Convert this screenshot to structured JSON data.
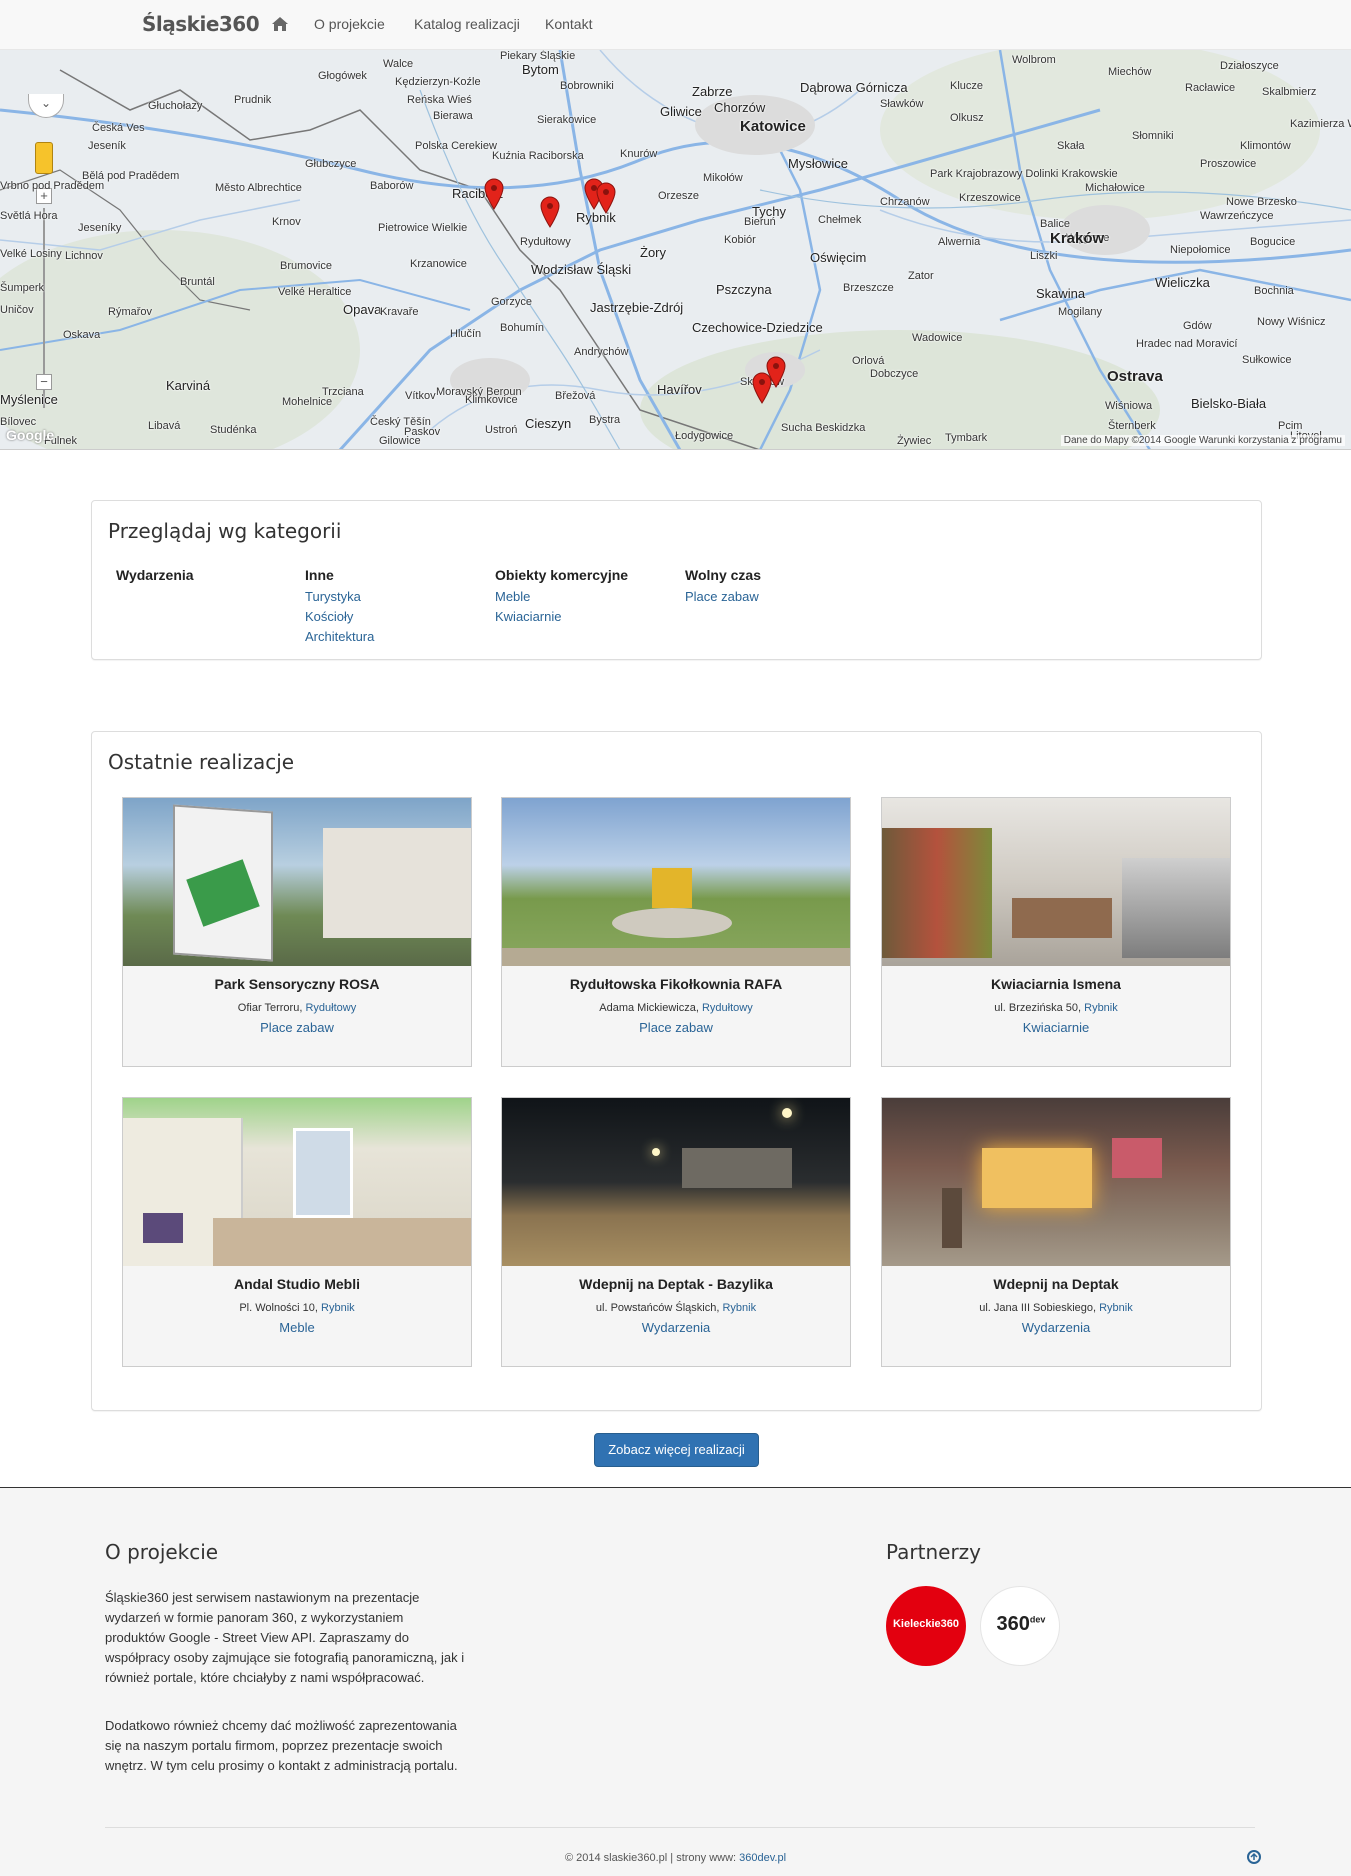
{
  "navbar": {
    "brand": "Śląskie360",
    "links": [
      "O projekcie",
      "Katalog realizacji",
      "Kontakt"
    ]
  },
  "map": {
    "labels": [
      {
        "t": "Walce"
      },
      {
        "t": "Kędzierzyn-Koźle"
      },
      {
        "t": "Piekary Śląskie"
      },
      {
        "t": "Bytom"
      },
      {
        "t": "Wolbrom"
      },
      {
        "t": "Miechów"
      },
      {
        "t": "Działoszyce"
      },
      {
        "t": "Głogówek"
      },
      {
        "t": "Bobrowniki"
      },
      {
        "t": "Prudnik"
      },
      {
        "t": "Zabrze"
      },
      {
        "t": "Dąbrowa Górnicza"
      },
      {
        "t": "Klucze"
      },
      {
        "t": "Racławice"
      },
      {
        "t": "Skalbmierz"
      },
      {
        "t": "Głuchołazy"
      },
      {
        "t": "Reńska Wieś"
      },
      {
        "t": "Gliwice"
      },
      {
        "t": "Chorzów"
      },
      {
        "t": "Katowice"
      },
      {
        "t": "Sławków"
      },
      {
        "t": "Olkusz"
      },
      {
        "t": "Kazimierza Wielka"
      },
      {
        "t": "Česká Ves"
      },
      {
        "t": "Bierawa"
      },
      {
        "t": "Sierakowice"
      },
      {
        "t": "Polska Cerekiew"
      },
      {
        "t": "Kuźnia Raciborska"
      },
      {
        "t": "Knurów"
      },
      {
        "t": "Mysłowice"
      },
      {
        "t": "Słomniki"
      },
      {
        "t": "Jeseník"
      },
      {
        "t": "Skała"
      },
      {
        "t": "Klimontów"
      },
      {
        "t": "Proszowice"
      },
      {
        "t": "Bělá pod Pradědem"
      },
      {
        "t": "Głubczyce"
      },
      {
        "t": "Mikołów"
      },
      {
        "t": "Park Krajobrazowy Dolinki Krakowskie"
      },
      {
        "t": "Baborów"
      },
      {
        "t": "Michałowice"
      },
      {
        "t": "Vrbno pod Pradědem"
      },
      {
        "t": "Město Albrechtice"
      },
      {
        "t": "Racibórz"
      },
      {
        "t": "Rybnik"
      },
      {
        "t": "Orzesze"
      },
      {
        "t": "Chrzanów"
      },
      {
        "t": "Krzeszowice"
      },
      {
        "t": "Nowe Brzesko"
      },
      {
        "t": "Wawrzeńczyce"
      },
      {
        "t": "Jeseníky"
      },
      {
        "t": "Krnov"
      },
      {
        "t": "Pietrowice Wielkie"
      },
      {
        "t": "Tychy"
      },
      {
        "t": "Bieruń"
      },
      {
        "t": "Chełmek"
      },
      {
        "t": "Balice"
      },
      {
        "t": "Węgrzce"
      },
      {
        "t": "Rydułtowy"
      },
      {
        "t": "Kobiór"
      },
      {
        "t": "Alwernia"
      },
      {
        "t": "Kraków"
      },
      {
        "t": "Světlá Hora"
      },
      {
        "t": "Lichnov"
      },
      {
        "t": "Żory"
      },
      {
        "t": "Oświęcim"
      },
      {
        "t": "Liszki"
      },
      {
        "t": "Niepołomice"
      },
      {
        "t": "Bogucice"
      },
      {
        "t": "Brumovice"
      },
      {
        "t": "Krzanowice"
      },
      {
        "t": "Wodzisław Śląski"
      },
      {
        "t": "Zator"
      },
      {
        "t": "Velké Losiny"
      },
      {
        "t": "Bruntál"
      },
      {
        "t": "Velké Heraltice"
      },
      {
        "t": "Pszczyna"
      },
      {
        "t": "Brzeszcze"
      },
      {
        "t": "Skawina"
      },
      {
        "t": "Wieliczka"
      },
      {
        "t": "Bochnia"
      },
      {
        "t": "Gorzyce"
      },
      {
        "t": "Jastrzębie-Zdrój"
      },
      {
        "t": "Rýmařov"
      },
      {
        "t": "Opava"
      },
      {
        "t": "Kravaře"
      },
      {
        "t": "Wadowice"
      },
      {
        "t": "Mogilany"
      },
      {
        "t": "Nowy Wiśnicz"
      },
      {
        "t": "Šumperk"
      },
      {
        "t": "Uničov"
      },
      {
        "t": "Czechowice-Dziedzice"
      },
      {
        "t": "Gdów"
      },
      {
        "t": "Oskava"
      },
      {
        "t": "Hlučín"
      },
      {
        "t": "Bohumín"
      },
      {
        "t": "Hradec nad Moravicí"
      },
      {
        "t": "Orlová"
      },
      {
        "t": "Dobczyce"
      },
      {
        "t": "Andrychów"
      },
      {
        "t": "Sułkowice"
      },
      {
        "t": "Karviná"
      },
      {
        "t": "Trzciana"
      },
      {
        "t": "Moravský Beroun"
      },
      {
        "t": "Břežová"
      },
      {
        "t": "Ostrava"
      },
      {
        "t": "Myślenice"
      },
      {
        "t": "Mohelnice"
      },
      {
        "t": "Vítkov"
      },
      {
        "t": "Klimkovice"
      },
      {
        "t": "Havířov"
      },
      {
        "t": "Skoczów"
      },
      {
        "t": "Bielsko-Biała"
      },
      {
        "t": "Wiśniowa"
      },
      {
        "t": "Bílovec"
      },
      {
        "t": "Český Těšín"
      },
      {
        "t": "Cieszyn"
      },
      {
        "t": "Bystra"
      },
      {
        "t": "Pcim"
      },
      {
        "t": "Šternberk"
      },
      {
        "t": "Libavá"
      },
      {
        "t": "Studénka"
      },
      {
        "t": "Paskov"
      },
      {
        "t": "Ustroń"
      },
      {
        "t": "Łodygowice"
      },
      {
        "t": "Sucha Beskidzka"
      },
      {
        "t": "Tymbark"
      },
      {
        "t": "Litovel"
      },
      {
        "t": "Fulnek"
      },
      {
        "t": "Gilowice"
      },
      {
        "t": "Żywiec"
      }
    ],
    "attribution": "Dane do Mapy ©2014 Google   Warunki korzystania z programu",
    "google_logo": "Google",
    "zoom_in": "+",
    "zoom_out": "−",
    "marker_color": "#e2231a"
  },
  "categories": {
    "title": "Przeglądaj wg kategorii",
    "columns": [
      {
        "head": "Wydarzenia",
        "links": []
      },
      {
        "head": "Inne",
        "links": [
          "Turystyka",
          "Kościoły",
          "Architektura"
        ]
      },
      {
        "head": "Obiekty komercyjne",
        "links": [
          "Meble",
          "Kwiaciarnie"
        ]
      },
      {
        "head": "Wolny czas",
        "links": [
          "Place zabaw"
        ]
      }
    ]
  },
  "recent": {
    "title": "Ostatnie realizacje",
    "cards": [
      {
        "title": "Park Sensoryczny ROSA",
        "street": "Ofiar Terroru, ",
        "city": "Rydułtowy",
        "category": "Place zabaw"
      },
      {
        "title": "Rydułtowska Fikołkownia RAFA",
        "street": "Adama Mickiewicza, ",
        "city": "Rydułtowy",
        "category": "Place zabaw"
      },
      {
        "title": "Kwiaciarnia Ismena",
        "street": "ul. Brzezińska 50, ",
        "city": "Rybnik",
        "category": "Kwiaciarnie"
      },
      {
        "title": "Andal Studio Mebli",
        "street": "Pl. Wolności 10, ",
        "city": "Rybnik",
        "category": "Meble"
      },
      {
        "title": "Wdepnij na Deptak - Bazylika",
        "street": "ul. Powstańców Śląskich, ",
        "city": "Rybnik",
        "category": "Wydarzenia"
      },
      {
        "title": "Wdepnij na Deptak",
        "street": "ul. Jana III Sobieskiego, ",
        "city": "Rybnik",
        "category": "Wydarzenia"
      }
    ],
    "more_button": "Zobacz więcej realizacji"
  },
  "footer": {
    "about_title": "O projekcie",
    "about_p1": "Śląskie360 jest serwisem nastawionym na prezentacje wydarzeń w formie panoram 360, z wykorzystaniem produktów Google - Street View API. Zapraszamy do współpracy osoby zajmujące sie fotografią panoramiczną, jak i również portale, które chciałyby z nami współpracować.",
    "about_p2": "Dodatkowo również chcemy dać możliwość zaprezentowania się na naszym portalu firmom, poprzez prezentacje swoich wnętrz. W tym celu prosimy o kontakt z administracją portalu.",
    "partners_title": "Partnerzy",
    "partner1": "Kieleckie360",
    "partner2": "360",
    "partner2_sub": "dev",
    "copyright_pre": "© 2014 slaskie360.pl | strony www: ",
    "copyright_link": "360dev.pl"
  }
}
